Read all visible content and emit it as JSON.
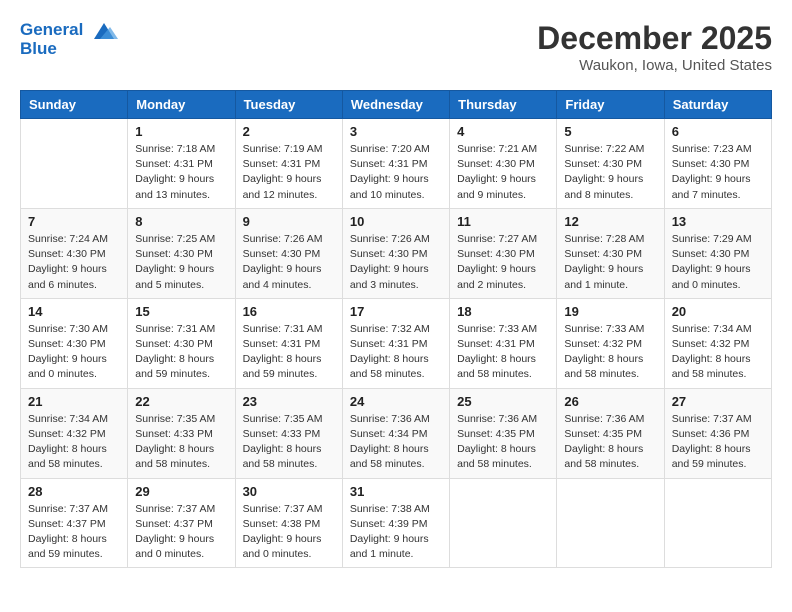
{
  "header": {
    "month": "December 2025",
    "location": "Waukon, Iowa, United States",
    "logo_line1_part1": "General",
    "logo_line2": "Blue"
  },
  "weekdays": [
    "Sunday",
    "Monday",
    "Tuesday",
    "Wednesday",
    "Thursday",
    "Friday",
    "Saturday"
  ],
  "weeks": [
    [
      {
        "day": "",
        "info": ""
      },
      {
        "day": "1",
        "info": "Sunrise: 7:18 AM\nSunset: 4:31 PM\nDaylight: 9 hours\nand 13 minutes."
      },
      {
        "day": "2",
        "info": "Sunrise: 7:19 AM\nSunset: 4:31 PM\nDaylight: 9 hours\nand 12 minutes."
      },
      {
        "day": "3",
        "info": "Sunrise: 7:20 AM\nSunset: 4:31 PM\nDaylight: 9 hours\nand 10 minutes."
      },
      {
        "day": "4",
        "info": "Sunrise: 7:21 AM\nSunset: 4:30 PM\nDaylight: 9 hours\nand 9 minutes."
      },
      {
        "day": "5",
        "info": "Sunrise: 7:22 AM\nSunset: 4:30 PM\nDaylight: 9 hours\nand 8 minutes."
      },
      {
        "day": "6",
        "info": "Sunrise: 7:23 AM\nSunset: 4:30 PM\nDaylight: 9 hours\nand 7 minutes."
      }
    ],
    [
      {
        "day": "7",
        "info": "Sunrise: 7:24 AM\nSunset: 4:30 PM\nDaylight: 9 hours\nand 6 minutes."
      },
      {
        "day": "8",
        "info": "Sunrise: 7:25 AM\nSunset: 4:30 PM\nDaylight: 9 hours\nand 5 minutes."
      },
      {
        "day": "9",
        "info": "Sunrise: 7:26 AM\nSunset: 4:30 PM\nDaylight: 9 hours\nand 4 minutes."
      },
      {
        "day": "10",
        "info": "Sunrise: 7:26 AM\nSunset: 4:30 PM\nDaylight: 9 hours\nand 3 minutes."
      },
      {
        "day": "11",
        "info": "Sunrise: 7:27 AM\nSunset: 4:30 PM\nDaylight: 9 hours\nand 2 minutes."
      },
      {
        "day": "12",
        "info": "Sunrise: 7:28 AM\nSunset: 4:30 PM\nDaylight: 9 hours\nand 1 minute."
      },
      {
        "day": "13",
        "info": "Sunrise: 7:29 AM\nSunset: 4:30 PM\nDaylight: 9 hours\nand 0 minutes."
      }
    ],
    [
      {
        "day": "14",
        "info": "Sunrise: 7:30 AM\nSunset: 4:30 PM\nDaylight: 9 hours\nand 0 minutes."
      },
      {
        "day": "15",
        "info": "Sunrise: 7:31 AM\nSunset: 4:30 PM\nDaylight: 8 hours\nand 59 minutes."
      },
      {
        "day": "16",
        "info": "Sunrise: 7:31 AM\nSunset: 4:31 PM\nDaylight: 8 hours\nand 59 minutes."
      },
      {
        "day": "17",
        "info": "Sunrise: 7:32 AM\nSunset: 4:31 PM\nDaylight: 8 hours\nand 58 minutes."
      },
      {
        "day": "18",
        "info": "Sunrise: 7:33 AM\nSunset: 4:31 PM\nDaylight: 8 hours\nand 58 minutes."
      },
      {
        "day": "19",
        "info": "Sunrise: 7:33 AM\nSunset: 4:32 PM\nDaylight: 8 hours\nand 58 minutes."
      },
      {
        "day": "20",
        "info": "Sunrise: 7:34 AM\nSunset: 4:32 PM\nDaylight: 8 hours\nand 58 minutes."
      }
    ],
    [
      {
        "day": "21",
        "info": "Sunrise: 7:34 AM\nSunset: 4:32 PM\nDaylight: 8 hours\nand 58 minutes."
      },
      {
        "day": "22",
        "info": "Sunrise: 7:35 AM\nSunset: 4:33 PM\nDaylight: 8 hours\nand 58 minutes."
      },
      {
        "day": "23",
        "info": "Sunrise: 7:35 AM\nSunset: 4:33 PM\nDaylight: 8 hours\nand 58 minutes."
      },
      {
        "day": "24",
        "info": "Sunrise: 7:36 AM\nSunset: 4:34 PM\nDaylight: 8 hours\nand 58 minutes."
      },
      {
        "day": "25",
        "info": "Sunrise: 7:36 AM\nSunset: 4:35 PM\nDaylight: 8 hours\nand 58 minutes."
      },
      {
        "day": "26",
        "info": "Sunrise: 7:36 AM\nSunset: 4:35 PM\nDaylight: 8 hours\nand 58 minutes."
      },
      {
        "day": "27",
        "info": "Sunrise: 7:37 AM\nSunset: 4:36 PM\nDaylight: 8 hours\nand 59 minutes."
      }
    ],
    [
      {
        "day": "28",
        "info": "Sunrise: 7:37 AM\nSunset: 4:37 PM\nDaylight: 8 hours\nand 59 minutes."
      },
      {
        "day": "29",
        "info": "Sunrise: 7:37 AM\nSunset: 4:37 PM\nDaylight: 9 hours\nand 0 minutes."
      },
      {
        "day": "30",
        "info": "Sunrise: 7:37 AM\nSunset: 4:38 PM\nDaylight: 9 hours\nand 0 minutes."
      },
      {
        "day": "31",
        "info": "Sunrise: 7:38 AM\nSunset: 4:39 PM\nDaylight: 9 hours\nand 1 minute."
      },
      {
        "day": "",
        "info": ""
      },
      {
        "day": "",
        "info": ""
      },
      {
        "day": "",
        "info": ""
      }
    ]
  ]
}
